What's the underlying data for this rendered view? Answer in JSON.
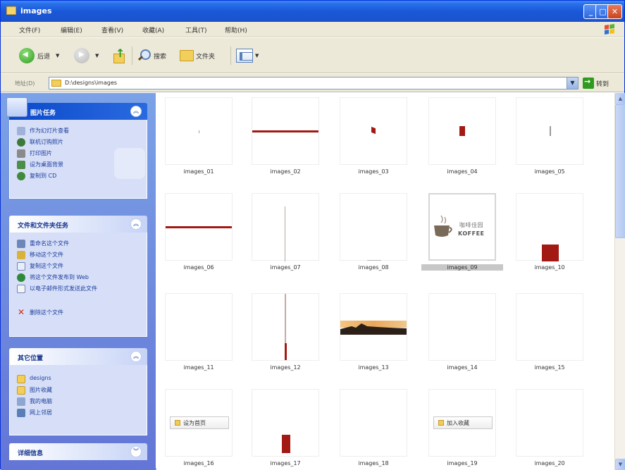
{
  "window": {
    "title": "images"
  },
  "menu": {
    "items": [
      "文件(F)",
      "编辑(E)",
      "查看(V)",
      "收藏(A)",
      "工具(T)",
      "帮助(H)"
    ]
  },
  "toolbar": {
    "back_label": "后退",
    "search_label": "搜索",
    "folders_label": "文件夹"
  },
  "address": {
    "label": "地址(D)",
    "value": "D:\\designs\\images",
    "go_label": "转到"
  },
  "taskpane": {
    "picture_tasks": {
      "title": "图片任务",
      "items": [
        "作为幻灯片查看",
        "联机订购照片",
        "打印图片",
        "设为桌面背景",
        "复制到 CD"
      ]
    },
    "file_tasks": {
      "title": "文件和文件夹任务",
      "items": [
        "重命名这个文件",
        "移动这个文件",
        "复制这个文件",
        "将这个文件发布到 Web",
        "以电子邮件形式发送此文件",
        "删除这个文件"
      ]
    },
    "other_places": {
      "title": "其它位置",
      "items": [
        "designs",
        "图片收藏",
        "我的电脑",
        "网上邻居"
      ]
    },
    "details": {
      "title": "详细信息"
    }
  },
  "files": [
    "images_01",
    "images_02",
    "images_03",
    "images_04",
    "images_05",
    "images_06",
    "images_07",
    "images_08",
    "images_09",
    "images_10",
    "images_11",
    "images_12",
    "images_13",
    "images_14",
    "images_15",
    "images_16",
    "images_17",
    "images_18",
    "images_19",
    "images_20"
  ],
  "thumbnail_text": {
    "coffee_line1": "咖啡佳园",
    "coffee_line2": "KOFFEE",
    "set_home_button": "设为首页",
    "add_favorite_button": "加入收藏"
  },
  "colors": {
    "titlebar": "#1958d8",
    "taskpane": "#6b8ee0",
    "mark_red": "#a31a14",
    "selection": "#c7c7c7"
  }
}
